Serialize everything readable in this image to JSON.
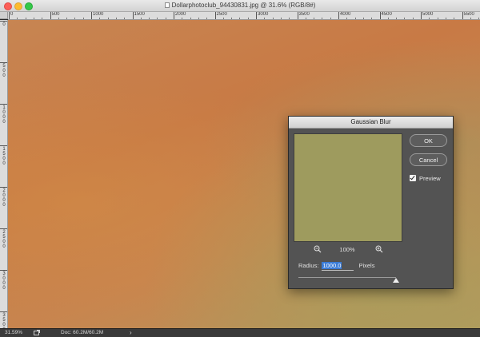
{
  "window": {
    "title": "Dollarphotoclub_94430831.jpg @ 31.6% (RGB/8#)"
  },
  "ruler": {
    "top_labels": [
      "0",
      "500",
      "1000",
      "1500",
      "2000",
      "2500",
      "3000",
      "3500",
      "4000",
      "4500",
      "5000",
      "5500"
    ],
    "left_labels": [
      "0",
      "5\n0\n0",
      "1\n0\n0\n0",
      "1\n5\n0\n0",
      "2\n0\n0\n0",
      "2\n5\n0\n0",
      "3\n0\n0\n0",
      "3\n5\n0\n0"
    ]
  },
  "statusbar": {
    "zoom": "31.59%",
    "doc_info": "Doc: 60.2M/60.2M",
    "chevron": "›"
  },
  "dialog": {
    "title": "Gaussian Blur",
    "ok_label": "OK",
    "cancel_label": "Cancel",
    "preview_label": "Preview",
    "preview_checked": true,
    "zoom_pct": "100%",
    "radius_label": "Radius:",
    "radius_value": "1000.0",
    "units": "Pixels",
    "slider_fraction": 1.0,
    "preview_color": "#9e9b5e"
  }
}
